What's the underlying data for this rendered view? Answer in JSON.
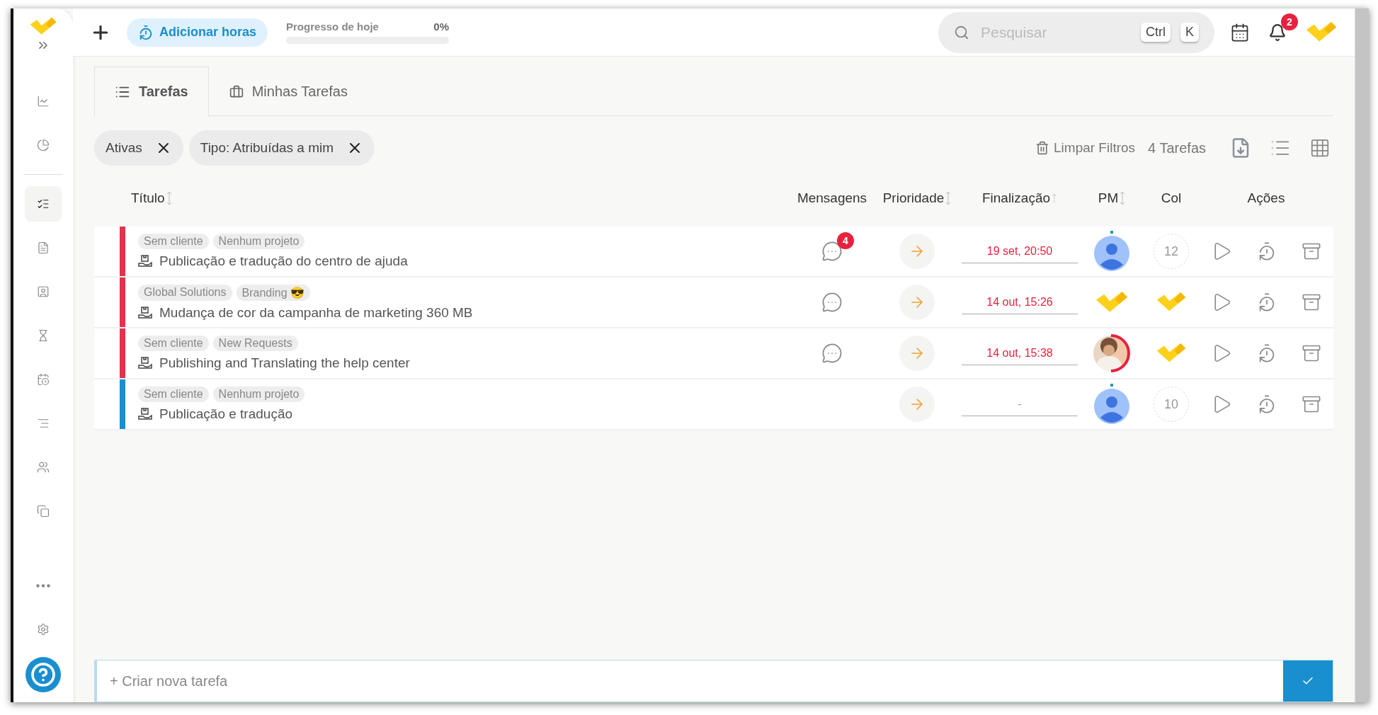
{
  "sidebar": {
    "items": [
      {
        "kind": "chart",
        "selected": false
      },
      {
        "kind": "pie",
        "selected": false
      },
      {
        "kind": "tasks",
        "selected": true
      },
      {
        "kind": "document",
        "selected": false
      },
      {
        "kind": "contact",
        "selected": false
      },
      {
        "kind": "hourglass",
        "selected": false
      },
      {
        "kind": "calendar",
        "selected": false
      },
      {
        "kind": "lines",
        "selected": false
      },
      {
        "kind": "users",
        "selected": false
      },
      {
        "kind": "copy",
        "selected": false
      }
    ],
    "bottom": [
      {
        "kind": "more"
      },
      {
        "kind": "settings"
      },
      {
        "kind": "help"
      }
    ]
  },
  "header": {
    "add_hours": "Adicionar horas",
    "progress": {
      "label": "Progresso de hoje",
      "value": "0%",
      "level": 0
    },
    "search": {
      "placeholder": "Pesquisar",
      "keys": [
        "Ctrl",
        "K"
      ]
    },
    "notifications": "2"
  },
  "tabs": [
    {
      "label": "Tarefas",
      "kind": "list",
      "selected": true
    },
    {
      "label": "Minhas Tarefas",
      "kind": "briefcase",
      "selected": false
    }
  ],
  "filters": [
    "Ativas",
    "Tipo: Atribuídas a mim"
  ],
  "toolbar": {
    "clear": "Limpar Filtros",
    "count": "4 Tarefas"
  },
  "columns": [
    {
      "label": "Título",
      "sortable": true,
      "ascending": false
    },
    {
      "label": "Mensagens",
      "sortable": false
    },
    {
      "label": "Prioridade",
      "sortable": true,
      "ascending": false
    },
    {
      "label": "Finalização",
      "sortable": true,
      "ascending": true
    },
    {
      "label": "PM",
      "sortable": true,
      "ascending": false
    },
    {
      "label": "Col",
      "sortable": false
    },
    {
      "label": "Ações",
      "sortable": false
    }
  ],
  "rows": [
    {
      "color": "#e0344f",
      "tags": [
        "Sem cliente",
        "Nenhum projeto"
      ],
      "title": "Publicação e tradução do centro de ajuda",
      "messages": true,
      "message_badge": "4",
      "due": "19 set, 20:50",
      "overdue": true,
      "pm": {
        "kind": "avatar"
      },
      "col": {
        "kind": "count",
        "text": "12"
      }
    },
    {
      "color": "#e0344f",
      "tags": [
        "Global Solutions",
        "Branding 😎"
      ],
      "title": "Mudança de cor da campanha de marketing 360 MB",
      "messages": true,
      "due": "14 out, 15:26",
      "overdue": true,
      "pm": {
        "kind": "logo"
      },
      "col": {
        "kind": "logo"
      }
    },
    {
      "color": "#e0344f",
      "tags": [
        "Sem cliente",
        "New Requests"
      ],
      "title": "Publishing and Translating the help center",
      "messages": true,
      "due": "14 out, 15:38",
      "overdue": true,
      "pm": {
        "kind": "picture"
      },
      "col": {
        "kind": "logo"
      }
    },
    {
      "color": "#1a8fcf",
      "tags": [
        "Sem cliente",
        "Nenhum projeto"
      ],
      "title": "Publicação e tradução",
      "messages": false,
      "due": "-",
      "overdue": false,
      "pm": {
        "kind": "avatar"
      },
      "col": {
        "kind": "count",
        "text": "10"
      }
    }
  ],
  "new_task": {
    "placeholder": "+ Criar nova tarefa"
  }
}
